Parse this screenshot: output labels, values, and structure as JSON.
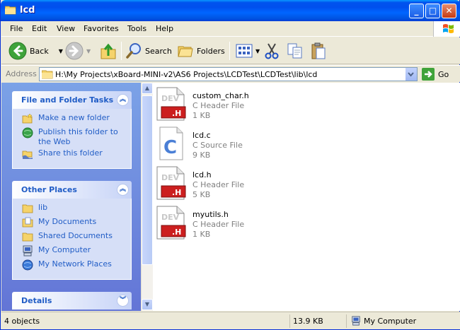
{
  "window": {
    "title": "lcd"
  },
  "menu": [
    "File",
    "Edit",
    "View",
    "Favorites",
    "Tools",
    "Help"
  ],
  "toolbar": {
    "back_label": "Back",
    "search_label": "Search",
    "folders_label": "Folders"
  },
  "address": {
    "label": "Address",
    "path": "H:\\My Projects\\xBoard-MINI-v2\\AS6 Projects\\LCDTest\\LCDTest\\lib\\lcd",
    "go_label": "Go"
  },
  "tasks": {
    "title": "File and Folder Tasks",
    "items": [
      "Make a new folder",
      "Publish this folder to the Web",
      "Share this folder"
    ]
  },
  "other_places": {
    "title": "Other Places",
    "items": [
      "lib",
      "My Documents",
      "Shared Documents",
      "My Computer",
      "My Network Places"
    ]
  },
  "details": {
    "title": "Details"
  },
  "files": [
    {
      "name": "custom_char.h",
      "type": "C Header File",
      "size": "1 KB",
      "icon": "header-file-icon"
    },
    {
      "name": "lcd.c",
      "type": "C Source File",
      "size": "9 KB",
      "icon": "c-source-file-icon"
    },
    {
      "name": "lcd.h",
      "type": "C Header File",
      "size": "5 KB",
      "icon": "header-file-icon"
    },
    {
      "name": "myutils.h",
      "type": "C Header File",
      "size": "1 KB",
      "icon": "header-file-icon"
    }
  ],
  "status": {
    "objects": "4 objects",
    "size": "13.9 KB",
    "location": "My Computer"
  }
}
